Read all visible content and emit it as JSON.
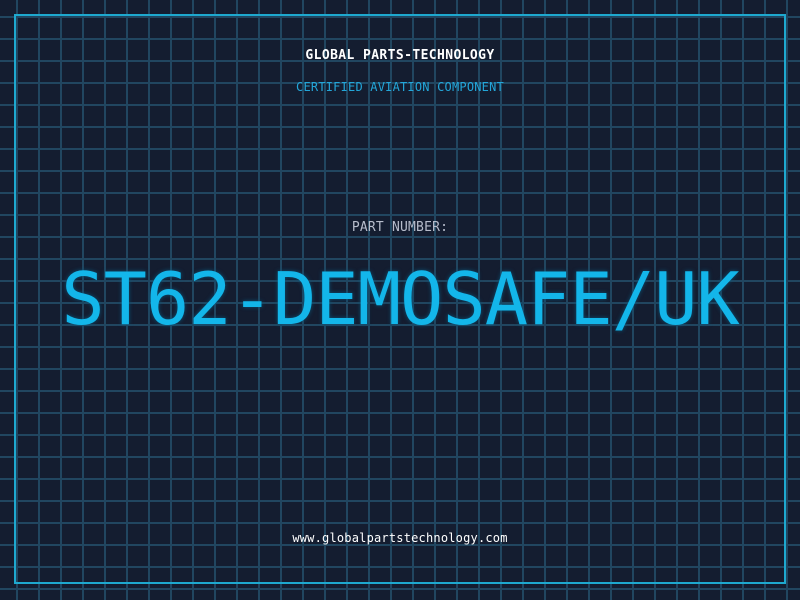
{
  "header": {
    "company": "GLOBAL PARTS-TECHNOLOGY",
    "subtitle": "CERTIFIED AVIATION COMPONENT"
  },
  "part": {
    "label": "PART NUMBER:",
    "number": "ST62-DEMOSAFE/UK"
  },
  "footer": {
    "website": "www.globalpartstechnology.com"
  },
  "colors": {
    "background": "#141d30",
    "grid": "#214660",
    "accent": "#1ea9cf",
    "part_number": "#13b6ea",
    "text": "#ffffff",
    "label": "#b6bccb"
  }
}
